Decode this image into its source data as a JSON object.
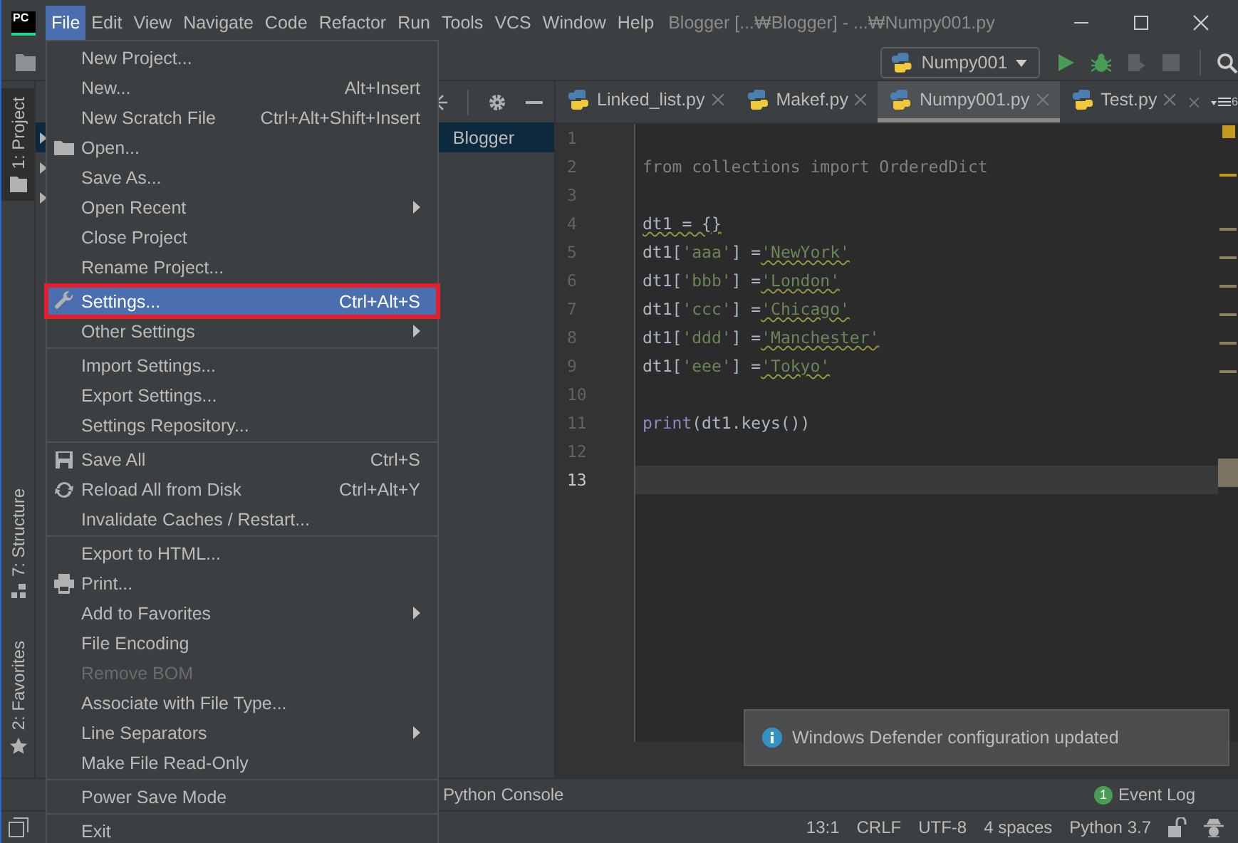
{
  "app_logo": "PC",
  "menu_bar": [
    {
      "label": "File",
      "selected": true
    },
    {
      "label": "Edit",
      "selected": false
    },
    {
      "label": "View",
      "selected": false
    },
    {
      "label": "Navigate",
      "selected": false
    },
    {
      "label": "Code",
      "selected": false
    },
    {
      "label": "Refactor",
      "selected": false
    },
    {
      "label": "Run",
      "selected": false
    },
    {
      "label": "Tools",
      "selected": false
    },
    {
      "label": "VCS",
      "selected": false
    },
    {
      "label": "Window",
      "selected": false
    },
    {
      "label": "Help",
      "selected": false
    }
  ],
  "window_title": "Blogger [...₩Blogger] - ...₩Numpy001.py",
  "run_config": "Numpy001",
  "left_tool_windows": [
    {
      "label": "1: Project",
      "selected": true
    },
    {
      "label": "7: Structure",
      "selected": false
    },
    {
      "label": "2: Favorites",
      "selected": false
    }
  ],
  "project_tree": {
    "root_label": "Blogger",
    "root_selected": true
  },
  "editor_tabs": [
    {
      "label": "Linked_list.py",
      "selected": false
    },
    {
      "label": "Makef.py",
      "selected": false
    },
    {
      "label": "Numpy001.py",
      "selected": true
    },
    {
      "label": "Test.py",
      "selected": false
    }
  ],
  "tab_overflow_count": "6",
  "code_lines": [
    {
      "number": "1",
      "current": false
    },
    {
      "number": "2",
      "current": false,
      "segments": [
        {
          "text": "from collections import OrderedDict",
          "kind": "unused",
          "squiggle": false
        }
      ]
    },
    {
      "number": "3",
      "current": false
    },
    {
      "number": "4",
      "current": false,
      "segments": [
        {
          "text": "dt1 = {}",
          "kind": "plain",
          "squiggle": true
        }
      ]
    },
    {
      "number": "5",
      "current": false,
      "segments": [
        {
          "text": "dt1[",
          "kind": "plain",
          "squiggle": false
        },
        {
          "text": "'aaa'",
          "kind": "string",
          "squiggle": false
        },
        {
          "text": "] =",
          "kind": "plain",
          "squiggle": false
        },
        {
          "text": "'NewYork'",
          "kind": "string",
          "squiggle": true
        }
      ]
    },
    {
      "number": "6",
      "current": false,
      "segments": [
        {
          "text": "dt1[",
          "kind": "plain",
          "squiggle": false
        },
        {
          "text": "'bbb'",
          "kind": "string",
          "squiggle": false
        },
        {
          "text": "] =",
          "kind": "plain",
          "squiggle": false
        },
        {
          "text": "'London'",
          "kind": "string",
          "squiggle": true
        }
      ]
    },
    {
      "number": "7",
      "current": false,
      "segments": [
        {
          "text": "dt1[",
          "kind": "plain",
          "squiggle": false
        },
        {
          "text": "'ccc'",
          "kind": "string",
          "squiggle": false
        },
        {
          "text": "] =",
          "kind": "plain",
          "squiggle": false
        },
        {
          "text": "'Chicago'",
          "kind": "string",
          "squiggle": true
        }
      ]
    },
    {
      "number": "8",
      "current": false,
      "segments": [
        {
          "text": "dt1[",
          "kind": "plain",
          "squiggle": false
        },
        {
          "text": "'ddd'",
          "kind": "string",
          "squiggle": false
        },
        {
          "text": "] =",
          "kind": "plain",
          "squiggle": false
        },
        {
          "text": "'Manchester'",
          "kind": "string",
          "squiggle": true
        }
      ]
    },
    {
      "number": "9",
      "current": false,
      "segments": [
        {
          "text": "dt1[",
          "kind": "plain",
          "squiggle": false
        },
        {
          "text": "'eee'",
          "kind": "string",
          "squiggle": false
        },
        {
          "text": "] =",
          "kind": "plain",
          "squiggle": false
        },
        {
          "text": "'Tokyo'",
          "kind": "string",
          "squiggle": true
        }
      ]
    },
    {
      "number": "10",
      "current": false
    },
    {
      "number": "11",
      "current": false,
      "segments": [
        {
          "text": "print",
          "kind": "builtin",
          "squiggle": false
        },
        {
          "text": "(dt1.keys())",
          "kind": "plain",
          "squiggle": false
        }
      ]
    },
    {
      "number": "12",
      "current": false
    },
    {
      "number": "13",
      "current": true
    }
  ],
  "file_menu": [
    [
      {
        "label": "New Project...",
        "disabled": false,
        "selected": false,
        "submenu": false,
        "highlighted": false
      },
      {
        "label": "New...",
        "shortcut": "Alt+Insert",
        "disabled": false,
        "selected": false,
        "submenu": false,
        "highlighted": false
      },
      {
        "label": "New Scratch File",
        "shortcut": "Ctrl+Alt+Shift+Insert",
        "disabled": false,
        "selected": false,
        "submenu": false,
        "highlighted": false
      },
      {
        "label": "Open...",
        "disabled": false,
        "selected": false,
        "submenu": false,
        "highlighted": false
      },
      {
        "label": "Save As...",
        "disabled": false,
        "selected": false,
        "submenu": false,
        "highlighted": false
      },
      {
        "label": "Open Recent",
        "disabled": false,
        "selected": false,
        "submenu": true,
        "highlighted": false
      },
      {
        "label": "Close Project",
        "disabled": false,
        "selected": false,
        "submenu": false,
        "highlighted": false
      },
      {
        "label": "Rename Project...",
        "disabled": false,
        "selected": false,
        "submenu": false,
        "highlighted": false
      }
    ],
    [
      {
        "label": "Settings...",
        "shortcut": "Ctrl+Alt+S",
        "disabled": false,
        "selected": true,
        "submenu": false,
        "highlighted": true
      },
      {
        "label": "Other Settings",
        "disabled": false,
        "selected": false,
        "submenu": true,
        "highlighted": false
      }
    ],
    [
      {
        "label": "Import Settings...",
        "disabled": false,
        "selected": false,
        "submenu": false,
        "highlighted": false
      },
      {
        "label": "Export Settings...",
        "disabled": false,
        "selected": false,
        "submenu": false,
        "highlighted": false
      },
      {
        "label": "Settings Repository...",
        "disabled": false,
        "selected": false,
        "submenu": false,
        "highlighted": false
      }
    ],
    [
      {
        "label": "Save All",
        "shortcut": "Ctrl+S",
        "disabled": false,
        "selected": false,
        "submenu": false,
        "highlighted": false
      },
      {
        "label": "Reload All from Disk",
        "shortcut": "Ctrl+Alt+Y",
        "disabled": false,
        "selected": false,
        "submenu": false,
        "highlighted": false
      },
      {
        "label": "Invalidate Caches / Restart...",
        "disabled": false,
        "selected": false,
        "submenu": false,
        "highlighted": false
      }
    ],
    [
      {
        "label": "Export to HTML...",
        "disabled": false,
        "selected": false,
        "submenu": false,
        "highlighted": false
      },
      {
        "label": "Print...",
        "disabled": false,
        "selected": false,
        "submenu": false,
        "highlighted": false
      },
      {
        "label": "Add to Favorites",
        "disabled": false,
        "selected": false,
        "submenu": true,
        "highlighted": false
      },
      {
        "label": "File Encoding",
        "disabled": false,
        "selected": false,
        "submenu": false,
        "highlighted": false
      },
      {
        "label": "Remove BOM",
        "disabled": true,
        "selected": false,
        "submenu": false,
        "highlighted": false
      },
      {
        "label": "Associate with File Type...",
        "disabled": false,
        "selected": false,
        "submenu": false,
        "highlighted": false
      },
      {
        "label": "Line Separators",
        "disabled": false,
        "selected": false,
        "submenu": true,
        "highlighted": false
      },
      {
        "label": "Make File Read-Only",
        "disabled": false,
        "selected": false,
        "submenu": false,
        "highlighted": false
      }
    ],
    [
      {
        "label": "Power Save Mode",
        "disabled": false,
        "selected": false,
        "submenu": false,
        "highlighted": false
      }
    ],
    [
      {
        "label": "Exit",
        "disabled": false,
        "selected": false,
        "submenu": false,
        "highlighted": false
      }
    ]
  ],
  "bottom_tools": {
    "console": "Python Console",
    "event_log": "Event Log",
    "event_count": "1"
  },
  "status_bar": [
    "13:1",
    "CRLF",
    "UTF-8",
    "4 spaces",
    "Python 3.7"
  ],
  "notification": {
    "text": "Windows Defender configuration updated"
  }
}
